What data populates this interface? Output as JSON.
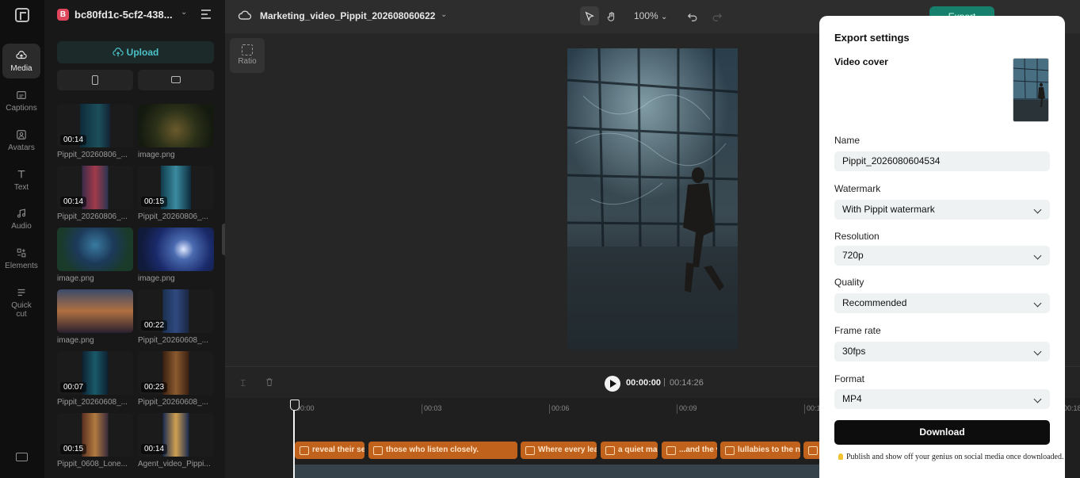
{
  "rail": {
    "items": [
      {
        "label": "Media",
        "icon": "media-cloud-icon",
        "active": true
      },
      {
        "label": "Captions",
        "icon": "captions-icon"
      },
      {
        "label": "Avatars",
        "icon": "avatar-icon"
      },
      {
        "label": "Text",
        "icon": "text-icon"
      },
      {
        "label": "Audio",
        "icon": "music-note-icon"
      },
      {
        "label": "Elements",
        "icon": "elements-icon"
      },
      {
        "label": "Quick",
        "label2": "cut",
        "icon": "quick-cut-icon"
      }
    ]
  },
  "panel": {
    "project_badge": "B",
    "project_name": "bc80fd1c-5cf2-438...",
    "upload_label": "Upload",
    "thumbs": [
      {
        "duration": "00:14",
        "label": "Pippit_20260806_..."
      },
      {
        "duration": "",
        "label": "image.png"
      },
      {
        "duration": "00:14",
        "label": "Pippit_20260806_..."
      },
      {
        "duration": "00:15",
        "label": "Pippit_20260806_..."
      },
      {
        "duration": "",
        "label": "image.png"
      },
      {
        "duration": "",
        "label": "image.png"
      },
      {
        "duration": "",
        "label": "image.png"
      },
      {
        "duration": "00:22",
        "label": "Pippit_20260608_..."
      },
      {
        "duration": "00:07",
        "label": "Pippit_20260608_..."
      },
      {
        "duration": "00:23",
        "label": "Pippit_20260608_..."
      },
      {
        "duration": "00:15",
        "label": "Pippit_0608_Lone..."
      },
      {
        "duration": "00:14",
        "label": "Agent_video_Pippi..."
      }
    ]
  },
  "topbar": {
    "title": "Marketing_video_Pippit_202608060622",
    "zoom": "100%",
    "export_label": "Export"
  },
  "canvas": {
    "ratio_label": "Ratio"
  },
  "timeline": {
    "current_time": "00:00:00",
    "separator": "|",
    "total_time": "00:14:26",
    "ticks": [
      "00:00",
      "00:03",
      "00:06",
      "00:09",
      "00:1",
      "00:18"
    ],
    "captions": [
      "reveal their se",
      "those who listen closely.",
      "Where every leaf",
      "a quiet ma",
      "...and the v",
      "lullabies to the ni",
      ""
    ]
  },
  "dialog": {
    "title": "Export settings",
    "video_cover_label": "Video cover",
    "name_label": "Name",
    "name_value": "Pippit_2026080604534",
    "watermark_label": "Watermark",
    "watermark_value": "With Pippit watermark",
    "resolution_label": "Resolution",
    "resolution_value": "720p",
    "quality_label": "Quality",
    "quality_value": "Recommended",
    "framerate_label": "Frame rate",
    "framerate_value": "30fps",
    "format_label": "Format",
    "format_value": "MP4",
    "download_label": "Download",
    "tip": "Publish and show off your genius on social media once downloaded."
  }
}
